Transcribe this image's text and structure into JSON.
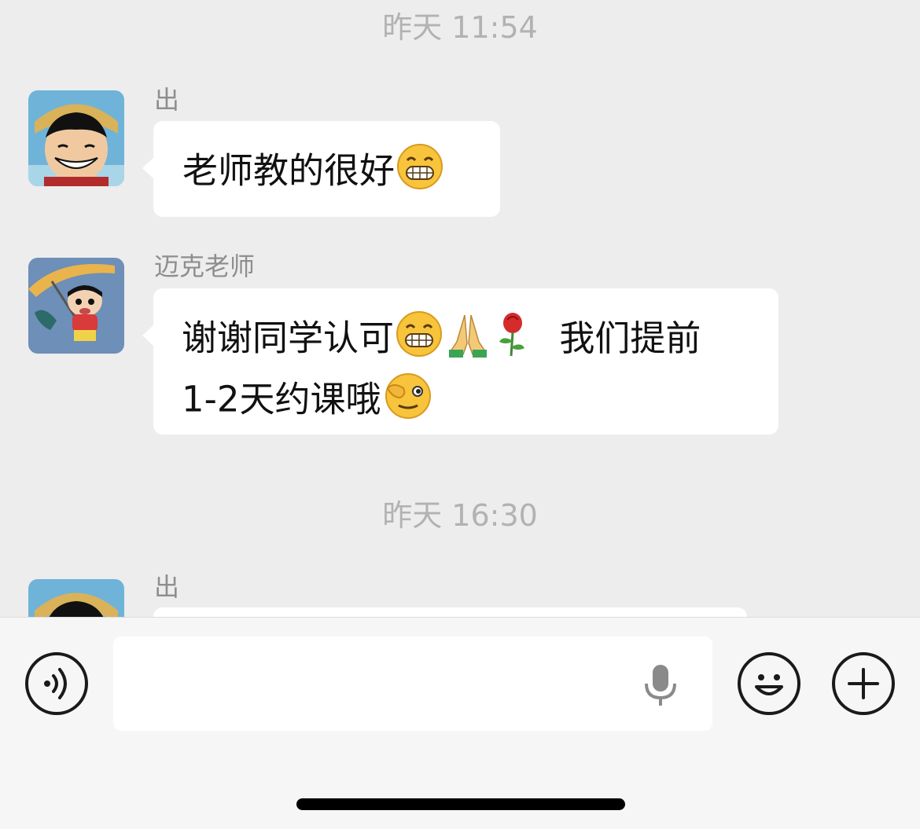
{
  "messages": [
    {
      "type": "timestamp",
      "text": "昨天 11:54"
    },
    {
      "type": "message",
      "sender": "出",
      "avatar": "luffy-avatar",
      "text": "老师教的很好",
      "emojis": [
        "grin-emoji"
      ]
    },
    {
      "type": "message",
      "sender": "迈克老师",
      "avatar": "shinchan-avatar",
      "line1": "谢谢同学认可",
      "line1_end": "我们提前",
      "line2": "1-2天约课哦",
      "emojis": [
        "grin-emoji",
        "pray-emoji",
        "rose-emoji",
        "wink-ok-emoji"
      ]
    },
    {
      "type": "timestamp",
      "text": "昨天 16:30"
    },
    {
      "type": "message",
      "sender": "出",
      "avatar": "luffy-avatar",
      "text": ""
    }
  ],
  "input_bar": {
    "placeholder": "",
    "icons": [
      "voice-icon",
      "microphone-icon",
      "emoji-icon",
      "plus-icon"
    ]
  },
  "colors": {
    "background": "#ededed",
    "bubble": "#ffffff",
    "timestamp": "#b2b2b2",
    "sender": "#8e8e8e"
  }
}
